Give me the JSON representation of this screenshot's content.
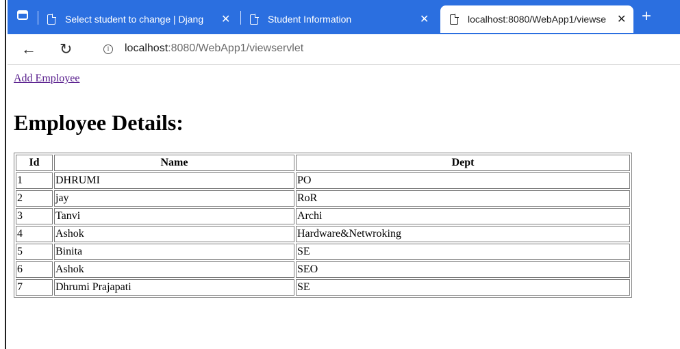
{
  "browser": {
    "tabs": [
      {
        "title": "Select student to change | Djang",
        "active": false
      },
      {
        "title": "Student Information",
        "active": false
      },
      {
        "title": "localhost:8080/WebApp1/viewse",
        "active": true
      }
    ],
    "close_glyph": "✕",
    "new_tab_glyph": "+",
    "address": {
      "host": "localhost",
      "path": ":8080/WebApp1/viewservlet"
    },
    "icons": [
      "tab-actions-icon",
      "page-icon",
      "close-icon",
      "new-tab-icon",
      "back-icon",
      "reload-icon",
      "info-icon"
    ],
    "accent_color": "#2b6fe0"
  },
  "page": {
    "add_link": "Add Employee",
    "heading": "Employee Details:",
    "table": {
      "headers": [
        "Id",
        "Name",
        "Dept"
      ],
      "rows": [
        [
          "1",
          "DHRUMI",
          "PO"
        ],
        [
          "2",
          "jay",
          "RoR"
        ],
        [
          "3",
          "Tanvi",
          "Archi"
        ],
        [
          "4",
          "Ashok",
          "Hardware&Netwroking"
        ],
        [
          "5",
          "Binita",
          "SE"
        ],
        [
          "6",
          "Ashok",
          "SEO"
        ],
        [
          "7",
          "Dhrumi Prajapati",
          "SE"
        ]
      ]
    }
  }
}
